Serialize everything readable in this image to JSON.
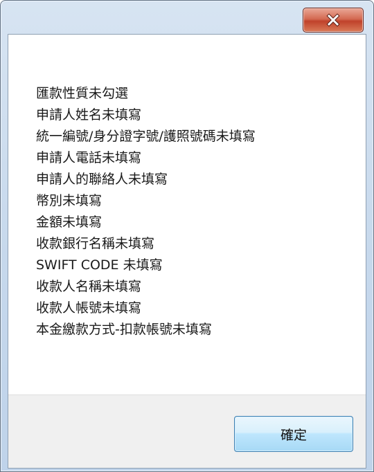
{
  "dialog": {
    "close_icon": "close-x-icon",
    "colors": {
      "close_button": "#c0422b",
      "frame": "#c6d8ec",
      "ok_button_border": "#3c7fb1"
    },
    "messages": [
      "匯款性質未勾選",
      "申請人姓名未填寫",
      "統一編號/身分證字號/護照號碼未填寫",
      "申請人電話未填寫",
      "申請人的聯絡人未填寫",
      "幣別未填寫",
      "金額未填寫",
      "收款銀行名稱未填寫",
      "SWIFT CODE 未填寫",
      "收款人名稱未填寫",
      "收款人帳號未填寫",
      "本金繳款方式-扣款帳號未填寫"
    ],
    "ok_label": "確定"
  }
}
